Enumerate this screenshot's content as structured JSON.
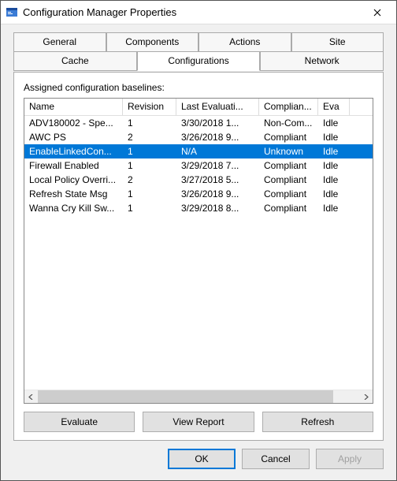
{
  "window": {
    "title": "Configuration Manager Properties"
  },
  "tabs": {
    "row1": [
      "General",
      "Components",
      "Actions",
      "Site"
    ],
    "row2": [
      "Cache",
      "Configurations",
      "Network"
    ],
    "active": "Configurations"
  },
  "panel": {
    "label": "Assigned configuration baselines:"
  },
  "listview": {
    "columns": [
      "Name",
      "Revision",
      "Last Evaluati...",
      "Complian...",
      "Eva"
    ],
    "rows": [
      {
        "name": "ADV180002 - Spe...",
        "revision": "1",
        "last_eval": "3/30/2018 1...",
        "compliance": "Non-Com...",
        "state": "Idle",
        "selected": false
      },
      {
        "name": "AWC PS",
        "revision": "2",
        "last_eval": "3/26/2018 9...",
        "compliance": "Compliant",
        "state": "Idle",
        "selected": false
      },
      {
        "name": "EnableLinkedCon...",
        "revision": "1",
        "last_eval": "N/A",
        "compliance": "Unknown",
        "state": "Idle",
        "selected": true
      },
      {
        "name": "Firewall Enabled",
        "revision": "1",
        "last_eval": "3/29/2018 7...",
        "compliance": "Compliant",
        "state": "Idle",
        "selected": false
      },
      {
        "name": "Local Policy Overri...",
        "revision": "2",
        "last_eval": "3/27/2018 5...",
        "compliance": "Compliant",
        "state": "Idle",
        "selected": false
      },
      {
        "name": "Refresh State Msg",
        "revision": "1",
        "last_eval": "3/26/2018 9...",
        "compliance": "Compliant",
        "state": "Idle",
        "selected": false
      },
      {
        "name": "Wanna Cry Kill Sw...",
        "revision": "1",
        "last_eval": "3/29/2018 8...",
        "compliance": "Compliant",
        "state": "Idle",
        "selected": false
      }
    ]
  },
  "buttons": {
    "evaluate": "Evaluate",
    "view_report": "View Report",
    "refresh": "Refresh",
    "ok": "OK",
    "cancel": "Cancel",
    "apply": "Apply"
  }
}
